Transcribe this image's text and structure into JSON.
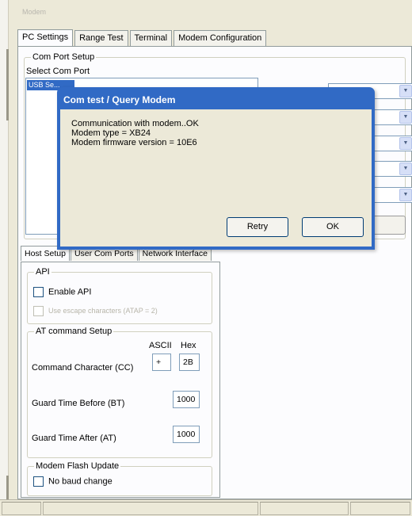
{
  "window": {
    "title": "Modem"
  },
  "main_tabs": [
    "PC Settings",
    "Range Test",
    "Terminal",
    "Modem Configuration"
  ],
  "com_port_setup": {
    "group_label": "Com Port Setup",
    "select_label": "Select Com Port",
    "selected_port": "USB Se..."
  },
  "dialog": {
    "title": "Com test / Query Modem",
    "lines": [
      "Communication with modem..OK",
      "Modem type = XB24",
      "Modem firmware version = 10E6"
    ],
    "retry_label": "Retry",
    "ok_label": "OK"
  },
  "lower_tabs": [
    "Host Setup",
    "User Com Ports",
    "Network Interface"
  ],
  "api": {
    "group_label": "API",
    "enable_label": "Enable API",
    "escape_label": "Use escape characters (ATAP = 2)"
  },
  "at_command": {
    "group_label": "AT command Setup",
    "ascii_label": "ASCII",
    "hex_label": "Hex",
    "command_char_label": "Command Character (CC)",
    "command_char_ascii": "+",
    "command_char_hex": "2B",
    "guard_before_label": "Guard Time Before (BT)",
    "guard_before_value": "1000",
    "guard_after_label": "Guard Time After (AT)",
    "guard_after_value": "1000"
  },
  "flash": {
    "group_label": "Modem Flash Update",
    "no_baud_label": "No baud change"
  }
}
